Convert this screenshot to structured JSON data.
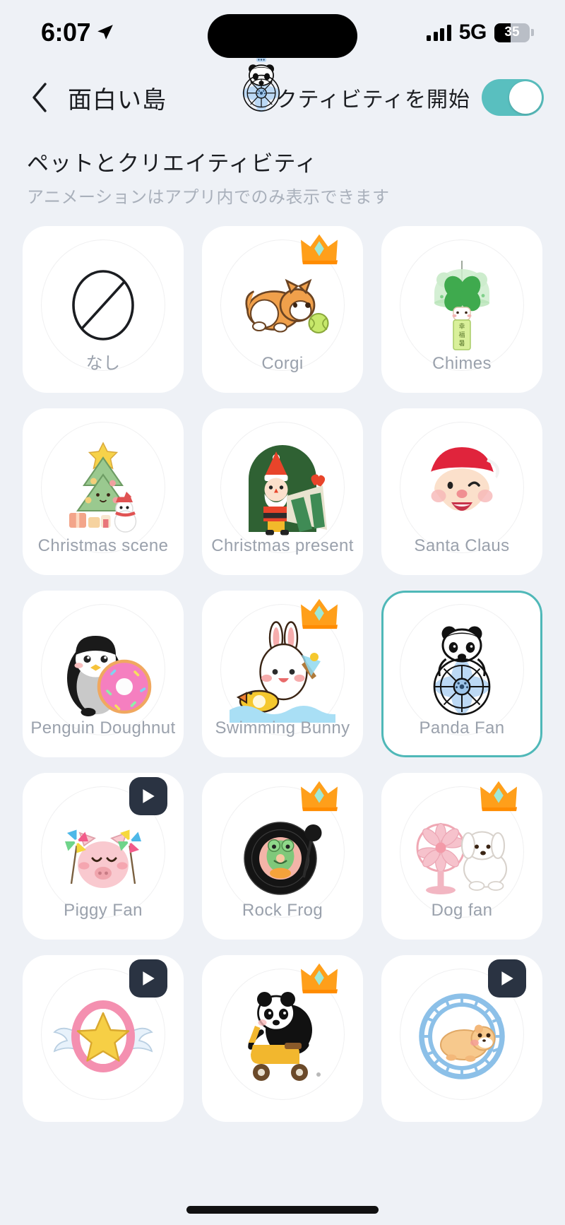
{
  "status_bar": {
    "time": "6:07",
    "location_icon": "location-arrow-icon",
    "signal_icon": "cellular-bars-icon",
    "network": "5G",
    "battery_percent": "35"
  },
  "nav": {
    "back_icon": "chevron-left-icon",
    "title": "面白い島",
    "activity_label": "アクティビティを開始",
    "toggle_on": true,
    "toggle_color": "#59bfbf",
    "floating_sticker_icon": "panda-fan-icon"
  },
  "section": {
    "title": "ペットとクリエイティビティ",
    "subtitle": "アニメーションはアプリ内でのみ表示できます"
  },
  "selected_item": "Panda Fan",
  "items": [
    {
      "label": "なし",
      "icon": "none-circle-slash-icon",
      "badge": "none",
      "selected": false
    },
    {
      "label": "Corgi",
      "icon": "corgi-icon",
      "badge": "crown",
      "selected": false
    },
    {
      "label": "Chimes",
      "icon": "wind-chime-icon",
      "badge": "none",
      "selected": false
    },
    {
      "label": "Christmas scene",
      "icon": "christmas-tree-icon",
      "badge": "none",
      "selected": false
    },
    {
      "label": "Christmas present",
      "icon": "santa-present-icon",
      "badge": "none",
      "selected": false
    },
    {
      "label": "Santa Claus",
      "icon": "santa-face-icon",
      "badge": "none",
      "selected": false
    },
    {
      "label": "Penguin Doughnut",
      "icon": "penguin-doughnut-icon",
      "badge": "none",
      "selected": false
    },
    {
      "label": "Swimming Bunny",
      "icon": "swimming-bunny-icon",
      "badge": "crown",
      "selected": false
    },
    {
      "label": "Panda Fan",
      "icon": "panda-fan-icon",
      "badge": "none",
      "selected": true
    },
    {
      "label": "Piggy Fan",
      "icon": "piggy-fan-icon",
      "badge": "play",
      "selected": false
    },
    {
      "label": "Rock Frog",
      "icon": "rock-frog-icon",
      "badge": "crown",
      "selected": false
    },
    {
      "label": "Dog fan",
      "icon": "dog-fan-icon",
      "badge": "crown",
      "selected": false
    },
    {
      "label": "",
      "icon": "winged-star-icon",
      "badge": "play",
      "selected": false
    },
    {
      "label": "",
      "icon": "panda-scooter-icon",
      "badge": "crown",
      "selected": false
    },
    {
      "label": "",
      "icon": "hamster-wheel-icon",
      "badge": "play",
      "selected": false
    }
  ]
}
